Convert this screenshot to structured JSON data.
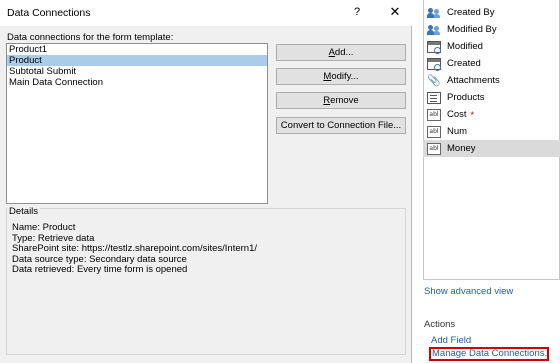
{
  "dialog": {
    "title": "Data Connections",
    "help_label": "?",
    "close_label": "✕",
    "list_label": "Data connections for the form template:",
    "connections": [
      "Product1",
      "Product",
      "Subtotal Submit",
      "Main Data Connection"
    ],
    "selected_index": 1,
    "buttons": {
      "add": {
        "underlined": "A",
        "rest": "dd..."
      },
      "modify": {
        "underlined": "M",
        "rest": "odify..."
      },
      "remove": {
        "underlined": "R",
        "rest": "emove"
      },
      "convert": {
        "underlined": "",
        "rest": "Convert to Connection File..."
      }
    },
    "details_label": "Details",
    "details": {
      "name": "Name: Product",
      "type": "Type: Retrieve data",
      "site": "SharePoint site: https://testlz.sharepoint.com/sites/Intern1/",
      "source_type": "Data source type: Secondary data source",
      "retrieved": "Data retrieved: Every time form is opened"
    }
  },
  "fields_pane": {
    "fields": [
      {
        "label": "Created By",
        "icon": "people-icon"
      },
      {
        "label": "Modified By",
        "icon": "people-icon"
      },
      {
        "label": "Modified",
        "icon": "calendar-icon"
      },
      {
        "label": "Created",
        "icon": "calendar-icon"
      },
      {
        "label": "Attachments",
        "icon": "paperclip-icon"
      },
      {
        "label": "Products",
        "icon": "form-icon"
      },
      {
        "label": "Cost",
        "icon": "text-field-icon",
        "required_mark": "*"
      },
      {
        "label": "Num",
        "icon": "text-field-icon"
      },
      {
        "label": "Money",
        "icon": "text-field-icon"
      }
    ],
    "selected_field": "Money",
    "abl_text": "abl",
    "clip_glyph": "📎",
    "show_advanced": "Show advanced view",
    "actions_header": "Actions",
    "add_field": "Add Field",
    "manage_connections": "Manage Data Connections...",
    "highlight_color": "#d00000",
    "link_color": "#1f5fa8"
  }
}
